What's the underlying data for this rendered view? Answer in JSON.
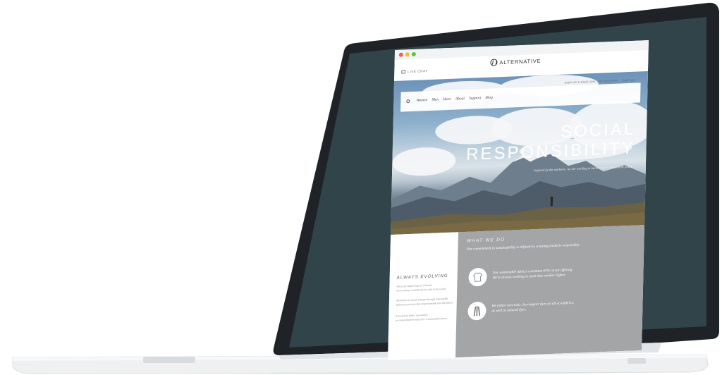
{
  "header": {
    "live_chat": "LIVE CHAT",
    "logo_text": "ALTERNATIVE"
  },
  "nav": {
    "links": [
      "Women",
      "Men",
      "More",
      "About",
      "Support",
      "Blog"
    ],
    "right_links": [
      "SIGN UP & SAVE 20%",
      "MY ACCOUNT",
      "CART (0)"
    ]
  },
  "hero": {
    "title_line1": "SOCIAL",
    "title_line2": "RESPONSIBILITY",
    "subtitle": "Inspired by the outdoors, we are working to harness for a sustainable future."
  },
  "always_evolving": {
    "title": "ALWAYS EVOLVING",
    "p1_line1": "Since our beginnings as a brand,",
    "p1_line2": "we've always considered our role in the world.",
    "p2_line1": "We believe in social change through responsible",
    "p2_line2": "business practices that respect people and the planet.",
    "p3_line1": "Focused on fabric innovation,",
    "p3_line2": "we make modern basics for a sustainable future."
  },
  "what_we_do": {
    "title": "WHAT WE DO",
    "intro": "Our commitment to sustainability is defined by creating products responsibly.",
    "feature1_line1": "Our sustainable fabrics constitute 65% of our offering.",
    "feature1_line2": "We're always working to push that number higher.",
    "feature2_line1": "We utilize non-toxic, low-impact dyes on all eco-fabrics,",
    "feature2_line2": "as well as natural dyes."
  },
  "icons": {
    "chat": "chat-icon",
    "search": "search-icon",
    "logo": "alternative-logo-icon",
    "shirt": "shirt-icon",
    "feathers": "feathers-icon"
  },
  "colors": {
    "screen_bezel": "#1f2226",
    "screen_bg": "#30444a",
    "laptop_base": "#eceeef",
    "panel_grey": "#a4a5a6"
  }
}
